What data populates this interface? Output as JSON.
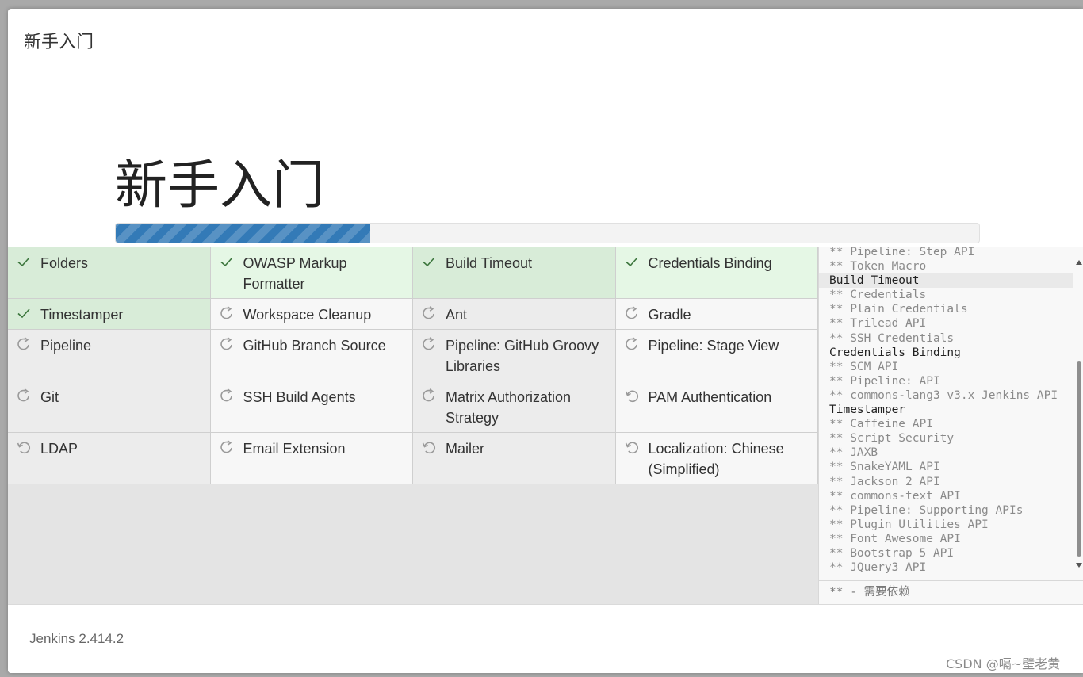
{
  "dialog": {
    "title": "新手入门",
    "heading": "新手入门",
    "progress": 0.295,
    "version": "Jenkins 2.414.2"
  },
  "plugins": [
    [
      {
        "name": "Folders",
        "status": "success"
      },
      {
        "name": "OWASP Markup Formatter",
        "status": "success"
      },
      {
        "name": "Build Timeout",
        "status": "success"
      },
      {
        "name": "Credentials Binding",
        "status": "success"
      }
    ],
    [
      {
        "name": "Timestamper",
        "status": "success"
      },
      {
        "name": "Workspace Cleanup",
        "status": "pending"
      },
      {
        "name": "Ant",
        "status": "pending"
      },
      {
        "name": "Gradle",
        "status": "pending"
      }
    ],
    [
      {
        "name": "Pipeline",
        "status": "pending"
      },
      {
        "name": "GitHub Branch Source",
        "status": "pending"
      },
      {
        "name": "Pipeline: GitHub Groovy Libraries",
        "status": "pending"
      },
      {
        "name": "Pipeline: Stage View",
        "status": "pending"
      }
    ],
    [
      {
        "name": "Git",
        "status": "pending"
      },
      {
        "name": "SSH Build Agents",
        "status": "pending"
      },
      {
        "name": "Matrix Authorization Strategy",
        "status": "pending"
      },
      {
        "name": "PAM Authentication",
        "status": "queued"
      }
    ],
    [
      {
        "name": "LDAP",
        "status": "queued"
      },
      {
        "name": "Email Extension",
        "status": "pending"
      },
      {
        "name": "Mailer",
        "status": "queued"
      },
      {
        "name": "Localization: Chinese (Simplified)",
        "status": "queued"
      }
    ]
  ],
  "status_icons": {
    "success": "check-icon",
    "pending": "refresh-icon",
    "queued": "undo-icon"
  },
  "colors": {
    "success_bg": "#e5f7e5",
    "success_bg_alt": "#d8ecd8",
    "pending_bg": "#f7f7f7",
    "pending_bg_alt": "#ececec",
    "progress": "#337ab7",
    "check": "#3c763d"
  },
  "log": {
    "lines": [
      {
        "text": "** Pipeline: Step API",
        "head": false
      },
      {
        "text": "** Token Macro",
        "head": false
      },
      {
        "text": "Build Timeout",
        "head": true,
        "active": true
      },
      {
        "text": "** Credentials",
        "head": false
      },
      {
        "text": "** Plain Credentials",
        "head": false
      },
      {
        "text": "** Trilead API",
        "head": false
      },
      {
        "text": "** SSH Credentials",
        "head": false
      },
      {
        "text": "Credentials Binding",
        "head": true
      },
      {
        "text": "** SCM API",
        "head": false
      },
      {
        "text": "** Pipeline: API",
        "head": false
      },
      {
        "text": "** commons-lang3 v3.x Jenkins API",
        "head": false
      },
      {
        "text": "Timestamper",
        "head": true
      },
      {
        "text": "** Caffeine API",
        "head": false
      },
      {
        "text": "** Script Security",
        "head": false
      },
      {
        "text": "** JAXB",
        "head": false
      },
      {
        "text": "** SnakeYAML API",
        "head": false
      },
      {
        "text": "** Jackson 2 API",
        "head": false
      },
      {
        "text": "** commons-text API",
        "head": false
      },
      {
        "text": "** Pipeline: Supporting APIs",
        "head": false
      },
      {
        "text": "** Plugin Utilities API",
        "head": false
      },
      {
        "text": "** Font Awesome API",
        "head": false
      },
      {
        "text": "** Bootstrap 5 API",
        "head": false
      },
      {
        "text": "** JQuery3 API",
        "head": false
      }
    ],
    "footer": "** - 需要依赖"
  },
  "watermark": "CSDN @嗝~壁老黄"
}
